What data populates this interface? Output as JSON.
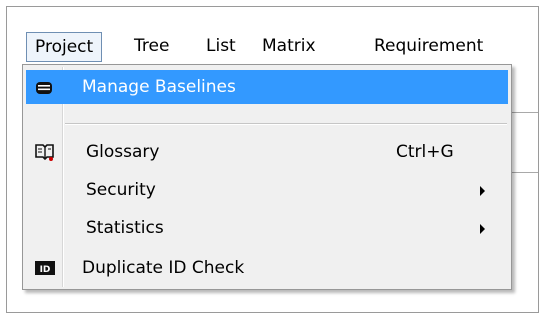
{
  "menubar": {
    "project": "Project",
    "tree": "Tree",
    "list": "List",
    "matrix": "Matrix",
    "requirement": "Requirement"
  },
  "dropdown": {
    "manage_baselines": "Manage Baselines",
    "glossary": "Glossary",
    "glossary_shortcut": "Ctrl+G",
    "security": "Security",
    "statistics": "Statistics",
    "duplicate_id_check": "Duplicate ID Check"
  },
  "icons": {
    "manage_baselines": "database-stack-icon",
    "glossary": "book-glossary-icon",
    "duplicate_id_check": "id-badge-icon"
  },
  "colors": {
    "highlight": "#3399ff",
    "menu_background": "#f0f0f0",
    "active_title_border": "#6f8fb3"
  }
}
